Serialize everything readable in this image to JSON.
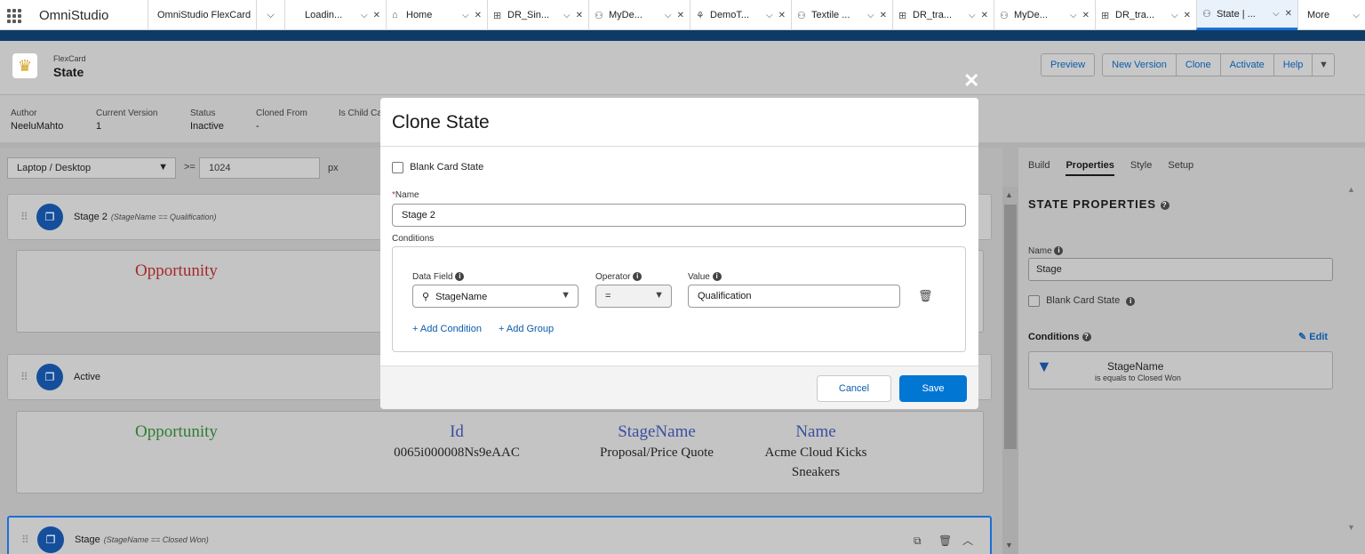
{
  "app": {
    "name": "OmniStudio"
  },
  "tabs": [
    {
      "label": "OmniStudio FlexCards",
      "icon": "",
      "has_close": false
    },
    {
      "label": "Loadin...",
      "icon": "",
      "has_close": true
    },
    {
      "label": "Home",
      "icon": "⌂",
      "has_close": true
    },
    {
      "label": "DR_Sin...",
      "icon": "⊞",
      "has_close": true
    },
    {
      "label": "MyDe...",
      "icon": "⚇",
      "has_close": true
    },
    {
      "label": "DemoT...",
      "icon": "⚘",
      "has_close": true
    },
    {
      "label": "Textile ...",
      "icon": "⚇",
      "has_close": true
    },
    {
      "label": "DR_tra...",
      "icon": "⊞",
      "has_close": true
    },
    {
      "label": "MyDe...",
      "icon": "⚇",
      "has_close": true
    },
    {
      "label": "DR_tra...",
      "icon": "⊞",
      "has_close": true
    },
    {
      "label": "State | ...",
      "icon": "⚇",
      "has_close": true
    }
  ],
  "more_label": "More",
  "header": {
    "object_label": "FlexCard",
    "title": "State",
    "buttons": {
      "preview": "Preview",
      "new_version": "New Version",
      "clone": "Clone",
      "activate": "Activate",
      "help": "Help"
    }
  },
  "details": [
    {
      "label": "Author",
      "value": "NeeluMahto"
    },
    {
      "label": "Current Version",
      "value": "1"
    },
    {
      "label": "Status",
      "value": "Inactive"
    },
    {
      "label": "Cloned From",
      "value": "-"
    },
    {
      "label": "Is Child Ca",
      "value": ""
    }
  ],
  "viewport": {
    "device": "Laptop / Desktop",
    "operator": ">=",
    "width": "1024",
    "unit": "px"
  },
  "states": [
    {
      "name": "Stage 2",
      "condition": "(StageName == Qualification)"
    },
    {
      "name": "Active",
      "condition": ""
    },
    {
      "name": "Stage",
      "condition": "(StageName == Closed Won)"
    }
  ],
  "card1": {
    "object": "Opportunity"
  },
  "card2": {
    "object": "Opportunity",
    "columns": [
      {
        "header": "Id",
        "value": "0065i000008Ns9eAAC"
      },
      {
        "header": "StageName",
        "value": "Proposal/Price Quote"
      },
      {
        "header": "Name",
        "value": "Acme Cloud Kicks",
        "value2": "Sneakers"
      }
    ]
  },
  "right_panel": {
    "tabs": [
      "Build",
      "Properties",
      "Style",
      "Setup"
    ],
    "title": "STATE PROPERTIES",
    "name_label": "Name",
    "name_value": "Stage",
    "blank_label": "Blank Card State",
    "conditions_label": "Conditions",
    "edit_label": "Edit",
    "condition_field": "StageName",
    "condition_text": "is equals to Closed Won"
  },
  "modal": {
    "title": "Clone State",
    "blank_label": "Blank Card State",
    "name_label": "Name",
    "name_value": "Stage 2",
    "conditions_label": "Conditions",
    "data_field_label": "Data Field",
    "data_field_value": "StageName",
    "operator_label": "Operator",
    "operator_value": "=",
    "value_label": "Value",
    "value_value": "Qualification",
    "add_condition": "+ Add Condition",
    "add_group": "+ Add Group",
    "cancel": "Cancel",
    "save": "Save"
  },
  "colors": {
    "brand": "#0176d3",
    "link": "#0b5cab",
    "state_icon": "#154f9c",
    "band": "#0e3a66",
    "opportunity_green": "#2e7d32",
    "opportunity_red": "#a52a2a"
  }
}
